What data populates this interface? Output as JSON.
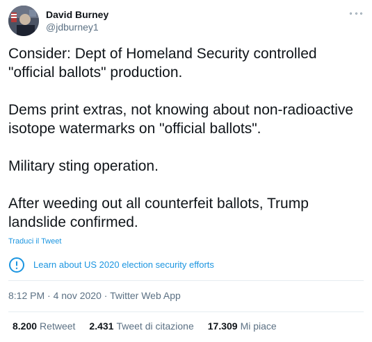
{
  "author": {
    "name": "David Burney",
    "handle": "@jdburney1"
  },
  "tweet": {
    "paragraphs": [
      "Consider: Dept of Homeland Security controlled \"official ballots\" production.",
      "Dems print extras, not knowing about non-radioactive isotope watermarks on \"official ballots\".",
      "Military sting operation.",
      "After weeding out all counterfeit ballots, Trump landslide confirmed."
    ],
    "translate_label": "Traduci il Tweet"
  },
  "notice": {
    "icon": "info-circle-icon",
    "label": "Learn about US 2020 election security efforts"
  },
  "meta": {
    "time": "8:12 PM",
    "date": "4 nov 2020",
    "source": "Twitter Web App",
    "separator": " · "
  },
  "stats": {
    "retweets_value": "8.200",
    "retweets_label": "Retweet",
    "quotes_value": "2.431",
    "quotes_label": "Tweet di citazione",
    "likes_value": "17.309",
    "likes_label": "Mi piace"
  },
  "colors": {
    "text": "#0f1419",
    "secondary": "#5b7083",
    "link": "#1b95e0",
    "divider": "#e6ecf0"
  }
}
